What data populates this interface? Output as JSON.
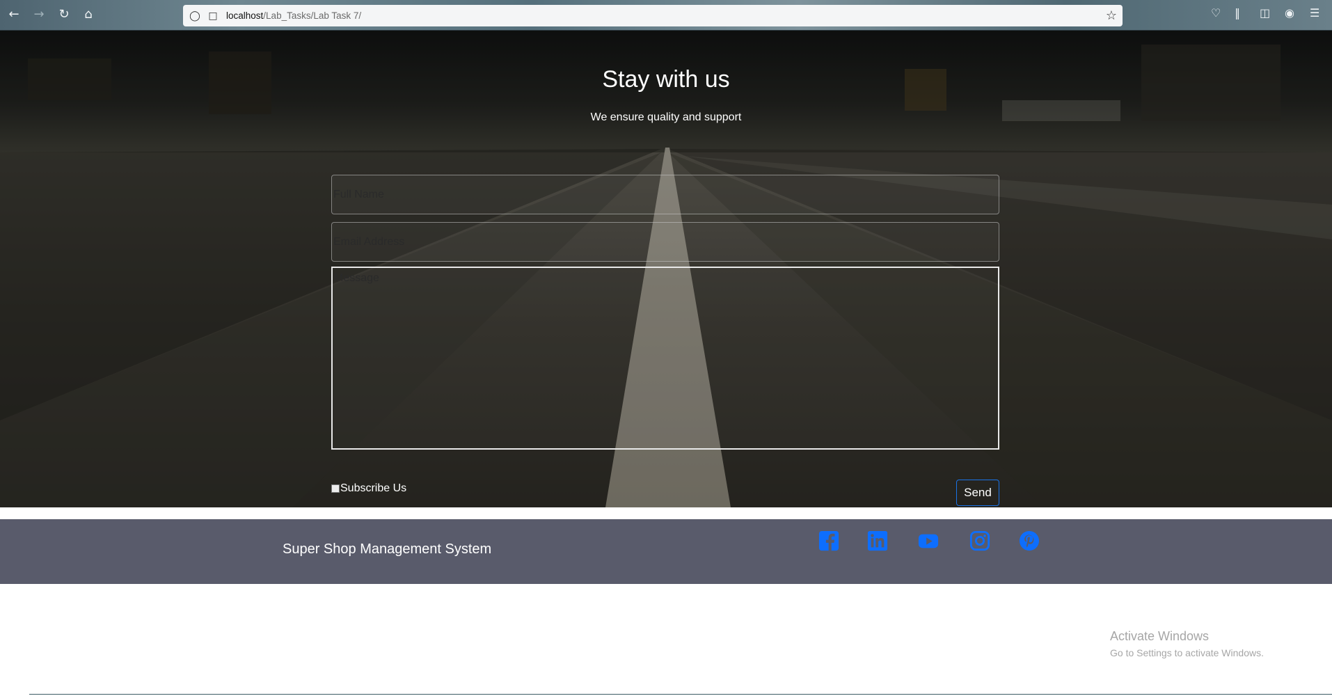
{
  "browser": {
    "url_host": "localhost",
    "url_path": "/Lab_Tasks/Lab Task 7/"
  },
  "hero": {
    "title": "Stay with us",
    "subtitle": "We ensure quality and support"
  },
  "form": {
    "name_placeholder": "Full Name",
    "email_placeholder": "Email Address",
    "message_placeholder": "Message",
    "subscribe_label": "Subscribe Us",
    "send_label": "Send"
  },
  "footer": {
    "brand": "Super Shop Management System",
    "social_color": "#0d6efd",
    "social": [
      "facebook-icon",
      "linkedin-icon",
      "youtube-icon",
      "instagram-icon",
      "pinterest-icon"
    ]
  },
  "watermark": {
    "line1": "Activate Windows",
    "line2": "Go to Settings to activate Windows."
  }
}
